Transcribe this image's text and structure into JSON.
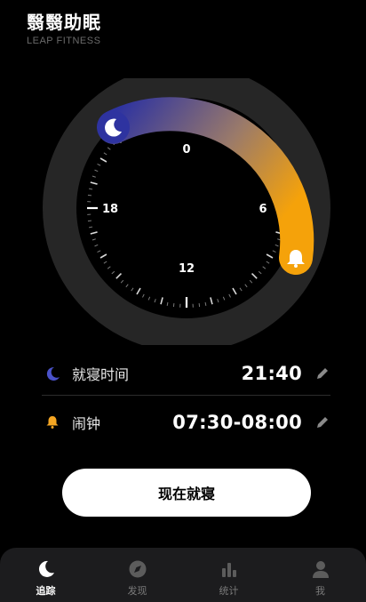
{
  "app": {
    "title": "翳翳助眠",
    "subtitle": "LEAP FITNESS"
  },
  "dial": {
    "hour_labels": {
      "top": "0",
      "right": "6",
      "bottom": "12",
      "left": "18"
    },
    "gradient_start": "#3a3fa0",
    "gradient_end": "#f5a20a",
    "moon_icon": "moon-icon",
    "alarm_icon": "bell-icon"
  },
  "bedtime": {
    "label": "就寝时间",
    "value": "21:40",
    "icon": "moon-icon",
    "icon_color": "#4a52c9"
  },
  "alarm": {
    "label": "闹钟",
    "value": "07:30-08:00",
    "icon": "bell-icon",
    "icon_color": "#f5a623"
  },
  "action": {
    "label": "现在就寝"
  },
  "tabs": [
    {
      "label": "追踪",
      "icon": "moon-icon",
      "active": true
    },
    {
      "label": "发现",
      "icon": "compass-icon",
      "active": false
    },
    {
      "label": "统计",
      "icon": "bar-chart-icon",
      "active": false
    },
    {
      "label": "我",
      "icon": "user-icon",
      "active": false
    }
  ]
}
